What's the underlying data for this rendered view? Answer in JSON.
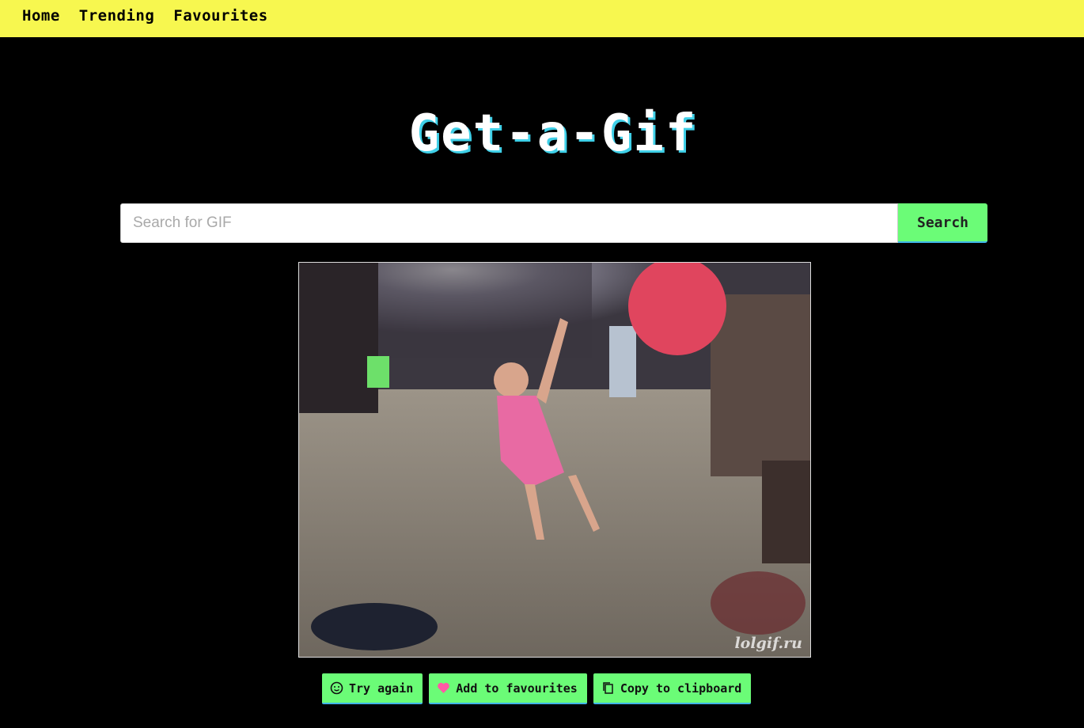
{
  "nav": {
    "items": [
      {
        "label": "Home"
      },
      {
        "label": "Trending"
      },
      {
        "label": "Favourites"
      }
    ]
  },
  "logo": {
    "text": "Get-a-Gif"
  },
  "search": {
    "placeholder": "Search for GIF",
    "value": "",
    "button_label": "Search"
  },
  "gif": {
    "watermark": "lolgif.ru",
    "description": "animated gif"
  },
  "actions": {
    "try_again": {
      "label": "Try again",
      "icon": "smiley-icon"
    },
    "add_favourite": {
      "label": "Add to favourites",
      "icon": "heart-icon"
    },
    "copy": {
      "label": "Copy to clipboard",
      "icon": "clipboard-icon"
    }
  },
  "colors": {
    "nav_bg": "#f7f74f",
    "page_bg": "#000000",
    "button_bg": "#6bfc77",
    "button_border": "#3fb5e8",
    "logo_shadow": "#3fd0e8",
    "heart": "#ff5aa5"
  }
}
